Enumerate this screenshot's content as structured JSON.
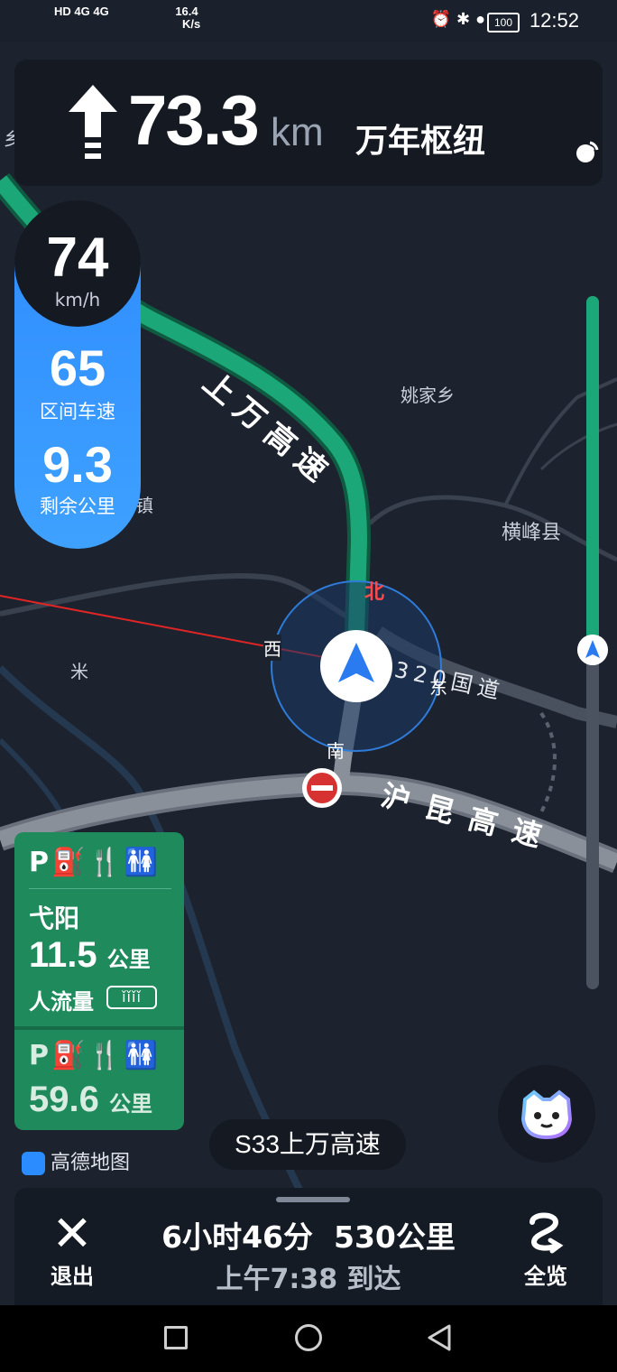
{
  "status_bar": {
    "network_left": "HD 4G 4G",
    "speed_value": "16.4",
    "speed_unit": "K/s",
    "battery": "100",
    "time": "12:52"
  },
  "navigation": {
    "distance_value": "73.3",
    "distance_unit": "km",
    "destination": "万年枢纽",
    "turn_icon": "arrow-up-icon"
  },
  "speed_panel": {
    "current_speed": "74",
    "speed_unit": "km/h",
    "section_avg_speed": "65",
    "section_avg_label": "区间车速",
    "remaining_distance": "9.3",
    "remaining_label": "剩余公里"
  },
  "map_labels": {
    "road_upper": "上万高速",
    "road_lower": "沪昆高速",
    "national_road": "320国道",
    "town_1": "姚家乡",
    "county": "横峰县",
    "compass_north": "北",
    "compass_south": "南",
    "compass_west": "西",
    "compass_east": "东",
    "misc_1": "米",
    "misc_2": "镇",
    "misc_3": "乡"
  },
  "service_areas": [
    {
      "name": "弋阳",
      "distance": "11.5",
      "unit": "公里",
      "crowd_label": "人流量",
      "facilities": "P⛽🍴🚻"
    },
    {
      "distance": "59.6",
      "unit": "公里",
      "facilities": "P⛽🍴🚻"
    }
  ],
  "brand": "高德地图",
  "current_road": "S33上万高速",
  "bottom_bar": {
    "exit_label": "退出",
    "remaining_time": "6小时46分",
    "remaining_distance": "530公里",
    "eta": "上午7:38 到达",
    "overview_label": "全览"
  },
  "route_progress": 0.5,
  "colors": {
    "route_green": "#1ba777",
    "speed_blue": "#2f8cff",
    "card_bg": "#141922",
    "service_green": "#1f8a5c",
    "map_bg": "#1c222e"
  }
}
